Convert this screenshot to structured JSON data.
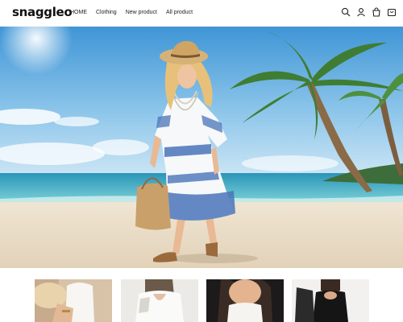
{
  "header": {
    "logo": "snaggleo",
    "nav": [
      {
        "label": "HOME"
      },
      {
        "label": "Clothing"
      },
      {
        "label": "New product"
      },
      {
        "label": "All product"
      }
    ],
    "icons": [
      "search-icon",
      "account-icon",
      "cart-icon",
      "wishlist-icon"
    ]
  },
  "hero": {
    "image": "beach-woman-white-dress-palm-trees"
  },
  "products": [
    {
      "image": "white-top-straw-bag"
    },
    {
      "image": "white-lace-blouse"
    },
    {
      "image": "white-corset-top"
    },
    {
      "image": "black-tank-dress"
    }
  ],
  "colors": {
    "sky": "#5aa7dd",
    "sea": "#3ab4c9",
    "sand": "#e9ddc8",
    "accent": "#121212"
  }
}
